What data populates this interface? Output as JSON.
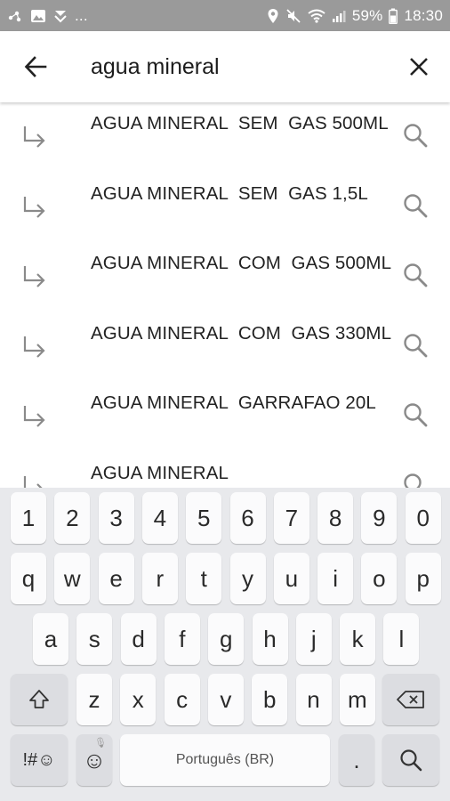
{
  "status_bar": {
    "battery": "59%",
    "time": "18:30",
    "left_icons": [
      "network-icon",
      "image-icon",
      "notification-icon"
    ],
    "more": "...",
    "right_icons": [
      "location-icon",
      "mute-icon",
      "wifi-icon",
      "signal-icon",
      "battery-icon"
    ]
  },
  "search": {
    "query": "agua mineral",
    "back_icon": "arrow-left-icon",
    "clear_icon": "close-icon"
  },
  "suggestions": [
    {
      "text": "AGUA MINERAL  SEM  GAS 500ML"
    },
    {
      "text": "AGUA MINERAL  SEM  GAS 1,5L"
    },
    {
      "text": "AGUA MINERAL  COM  GAS 500ML"
    },
    {
      "text": "AGUA MINERAL  COM  GAS 330ML"
    },
    {
      "text": "AGUA MINERAL  GARRAFAO 20L"
    },
    {
      "text": "AGUA MINERAL"
    }
  ],
  "keyboard": {
    "row1": [
      "1",
      "2",
      "3",
      "4",
      "5",
      "6",
      "7",
      "8",
      "9",
      "0"
    ],
    "row2": [
      "q",
      "w",
      "e",
      "r",
      "t",
      "y",
      "u",
      "i",
      "o",
      "p"
    ],
    "row3": [
      "a",
      "s",
      "d",
      "f",
      "g",
      "h",
      "j",
      "k",
      "l"
    ],
    "row4": [
      "z",
      "x",
      "c",
      "v",
      "b",
      "n",
      "m"
    ],
    "symbols_label": "!#☺",
    "emoji_label": "☺",
    "space_label": "Português (BR)",
    "period_label": ".",
    "colors": {
      "background": "#e8e9ec",
      "key": "#fbfbfc",
      "function_key": "#dcdde1"
    }
  }
}
